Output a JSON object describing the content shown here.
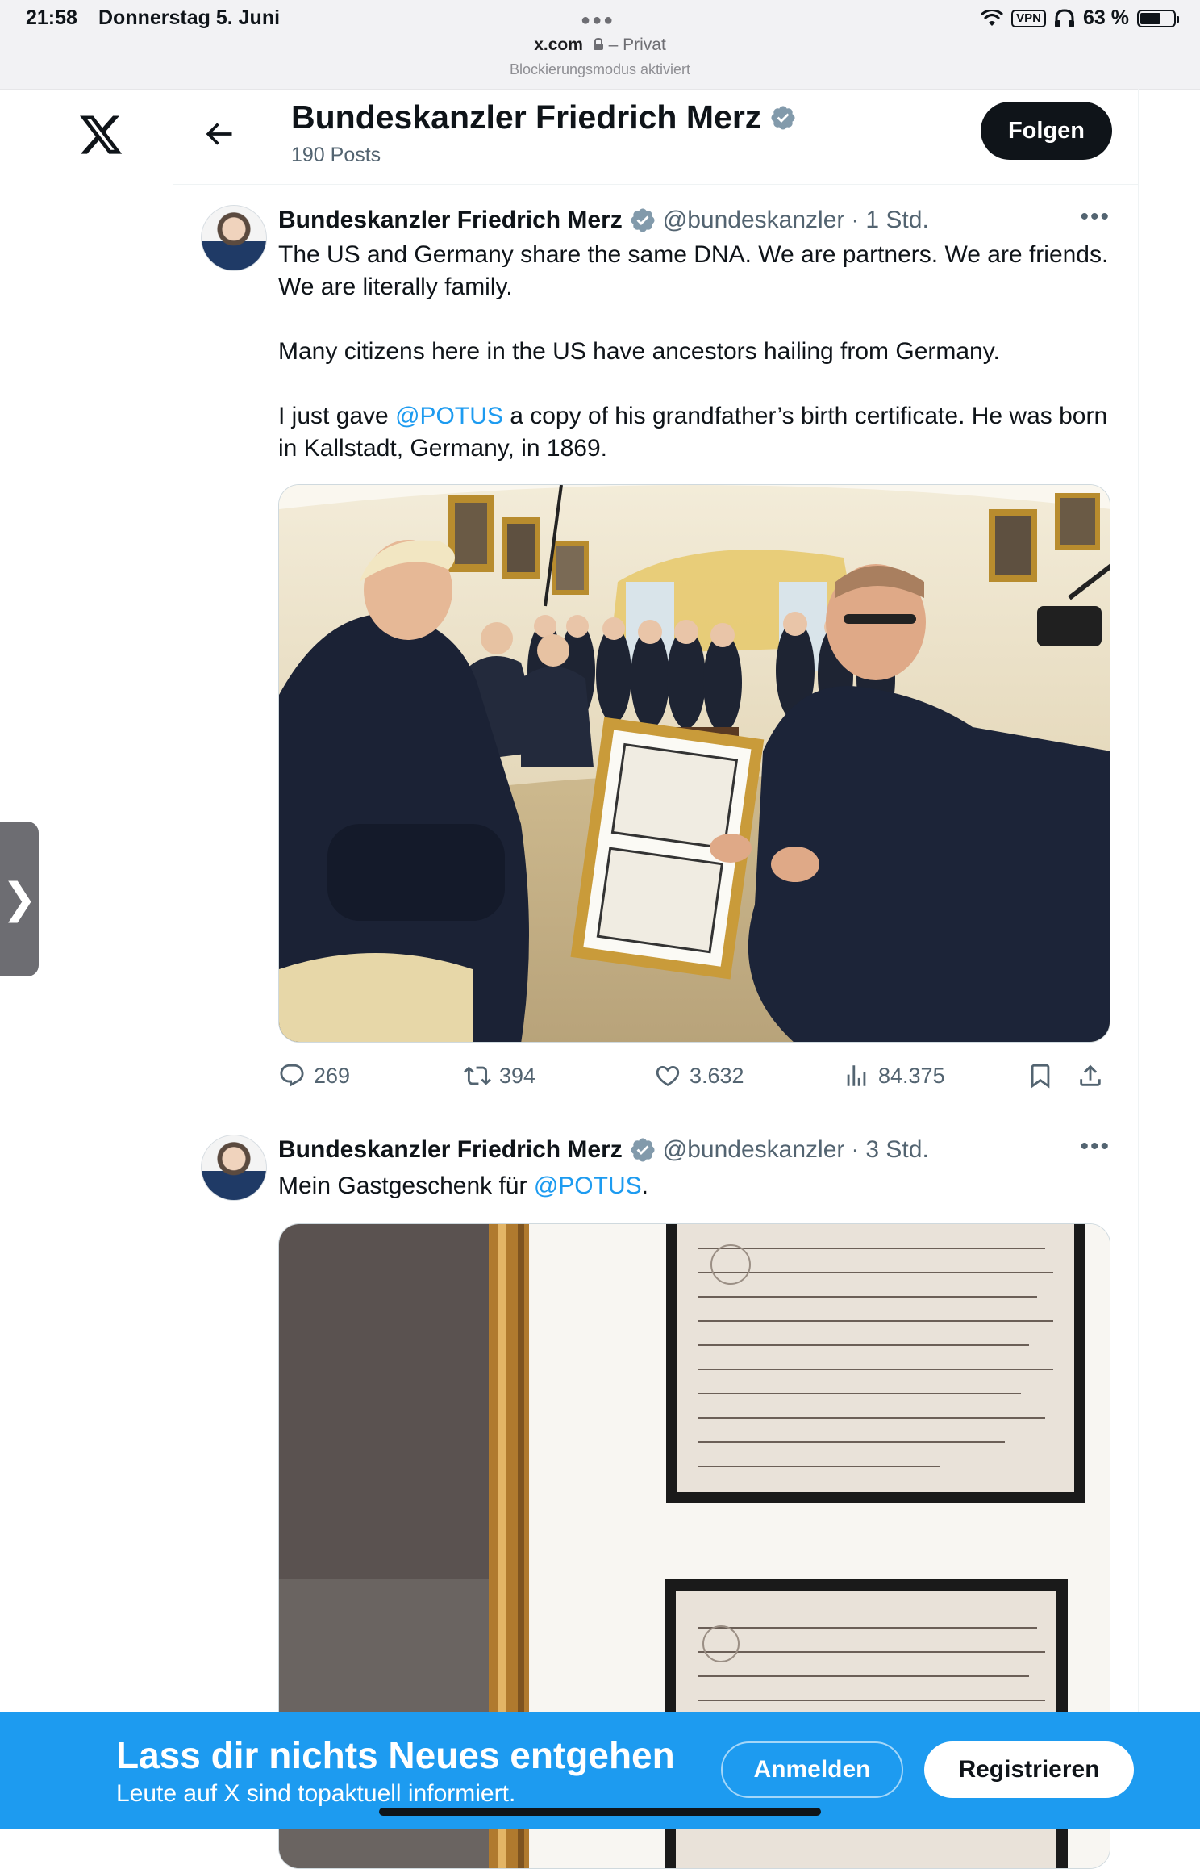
{
  "status_bar": {
    "time": "21:58",
    "date": "Donnerstag 5. Juni",
    "vpn": "VPN",
    "battery": "63 %",
    "battery_level": 0.63
  },
  "browser": {
    "domain": "x.com",
    "privacy": " – Privat",
    "lockdown": "Blockierungsmodus aktiviert"
  },
  "header": {
    "title": "Bundeskanzler Friedrich Merz",
    "posts": "190 Posts",
    "follow": "Folgen"
  },
  "tweets": [
    {
      "name": "Bundeskanzler Friedrich Merz",
      "handle": "@bundeskanzler",
      "sep": "·",
      "time": "1 Std.",
      "more": "•••",
      "p1": "The US and Germany share the same DNA. We are partners. We are friends. We are literally family.",
      "p2": "Many citizens here in the US have ancestors hailing from Germany.",
      "p3_before": "I just gave ",
      "p3_mention": "@POTUS",
      "p3_after": " a copy of his grandfather’s birth certificate. He was born in Kallstadt, Germany, in 1869.",
      "replies": "269",
      "reposts": "394",
      "likes": "3.632",
      "views": "84.375"
    },
    {
      "name": "Bundeskanzler Friedrich Merz",
      "handle": "@bundeskanzler",
      "sep": "·",
      "time": "3 Std.",
      "more": "•••",
      "text_before": "Mein Gastgeschenk für ",
      "mention": "@POTUS",
      "text_after": "."
    }
  ],
  "banner": {
    "title": "Lass dir nichts Neues entgehen",
    "subtitle": "Leute auf X sind topaktuell informiert.",
    "login": "Anmelden",
    "signup": "Registrieren"
  },
  "colors": {
    "accent": "#1d9bf0",
    "text": "#0f1419",
    "secondary": "#536471",
    "border": "#eff3f4"
  }
}
